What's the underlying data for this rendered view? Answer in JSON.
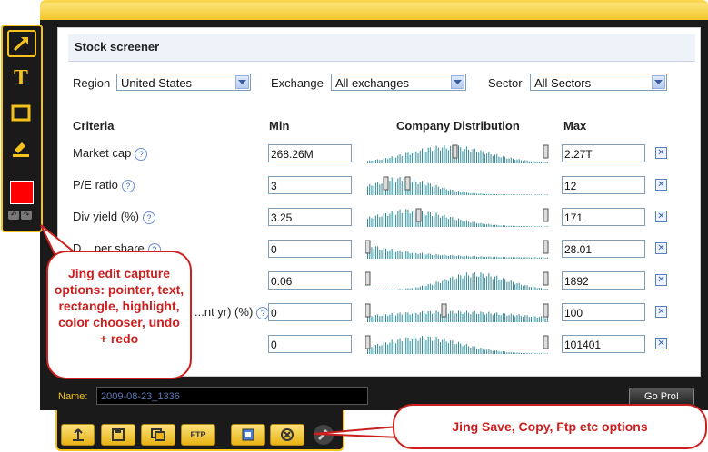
{
  "screener": {
    "title": "Stock screener",
    "filters": [
      {
        "label": "Region",
        "value": "United States"
      },
      {
        "label": "Exchange",
        "value": "All exchanges"
      },
      {
        "label": "Sector",
        "value": "All Sectors"
      }
    ],
    "columns": {
      "criteria": "Criteria",
      "min": "Min",
      "distribution": "Company Distribution",
      "max": "Max"
    },
    "rows": [
      {
        "label": "Market cap",
        "min": "268.26M",
        "max": "2.27T"
      },
      {
        "label": "P/E ratio",
        "min": "3",
        "max": "12"
      },
      {
        "label": "Div yield (%)",
        "min": "3.25",
        "max": "171"
      },
      {
        "label": "D... per share",
        "min": "0",
        "max": "28.01"
      },
      {
        "label": "",
        "min": "0.06",
        "max": "1892"
      },
      {
        "label": "...nt yr) (%)",
        "min": "0",
        "max": "100"
      },
      {
        "label": "",
        "min": "0",
        "max": "101401"
      }
    ],
    "help_icon": "?",
    "remove_icon": "✕"
  },
  "capture": {
    "name_label": "Name:",
    "name_value": "2009-08-23_1336",
    "go_pro": "Go Pro!"
  },
  "toolbar": {
    "tools": [
      "pointer-icon",
      "text-icon",
      "rectangle-icon",
      "highlight-icon"
    ],
    "text_tool_glyph": "T",
    "selected_color": "#ff0000"
  },
  "bottom_bar": {
    "ftp_label": "FTP"
  },
  "callouts": {
    "left": "Jing edit capture options: pointer, text, rectangle, highlight, color chooser, undo + redo",
    "bottom": "Jing Save, Copy, Ftp etc options"
  },
  "colors": {
    "accent": "#f4c21a",
    "callout": "#cc1f1f",
    "dark": "#1a1a1a",
    "histogram": "#2d8a96"
  }
}
